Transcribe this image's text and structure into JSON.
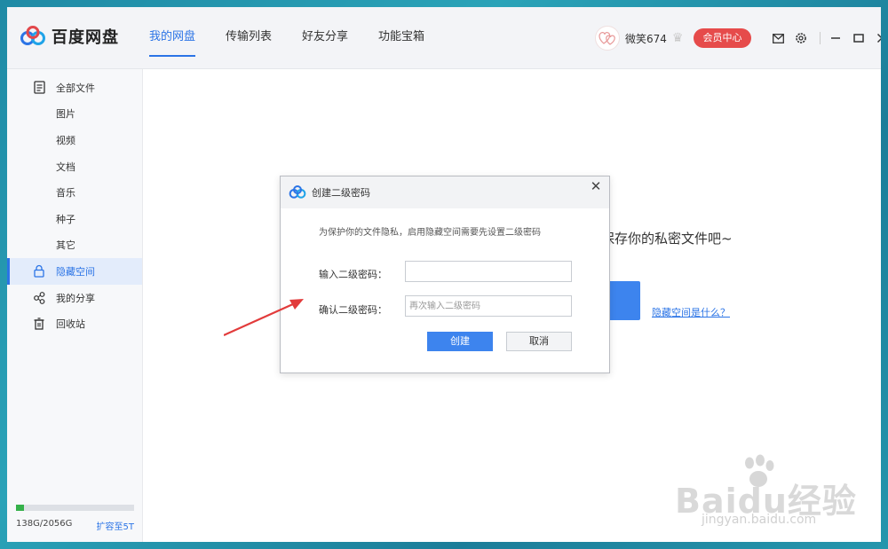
{
  "app": {
    "name": "百度网盘",
    "nav": [
      "我的网盘",
      "传输列表",
      "好友分享",
      "功能宝箱"
    ],
    "active_nav": 0,
    "username": "微笑674",
    "vip_button": "会员中心"
  },
  "sidebar": {
    "items": [
      {
        "label": "全部文件",
        "icon": "file-icon"
      },
      {
        "label": "图片"
      },
      {
        "label": "视频"
      },
      {
        "label": "文档"
      },
      {
        "label": "音乐"
      },
      {
        "label": "种子"
      },
      {
        "label": "其它"
      },
      {
        "label": "隐藏空间",
        "icon": "lock-icon",
        "active": true
      },
      {
        "label": "我的分享",
        "icon": "share-icon"
      },
      {
        "label": "回收站",
        "icon": "trash-icon"
      }
    ],
    "storage_text": "138G/2056G",
    "storage_used_fraction": 0.067,
    "expand_label": "扩容至5T"
  },
  "main": {
    "background_text": "保存你的私密文件吧~",
    "link_text": "隐藏空间是什么？"
  },
  "dialog": {
    "title": "创建二级密码",
    "description": "为保护你的文件隐私，启用隐藏空间需要先设置二级密码",
    "password_label": "输入二级密码：",
    "password_value": "",
    "confirm_label": "确认二级密码：",
    "confirm_placeholder": "再次输入二级密码",
    "create_button": "创建",
    "cancel_button": "取消"
  },
  "watermark": {
    "main": "Baidu经验",
    "sub": "jingyan.baidu.com"
  },
  "colors": {
    "accent": "#2b74e6",
    "vip": "#e64b4b",
    "annotation_arrow": "#e23b3b"
  }
}
